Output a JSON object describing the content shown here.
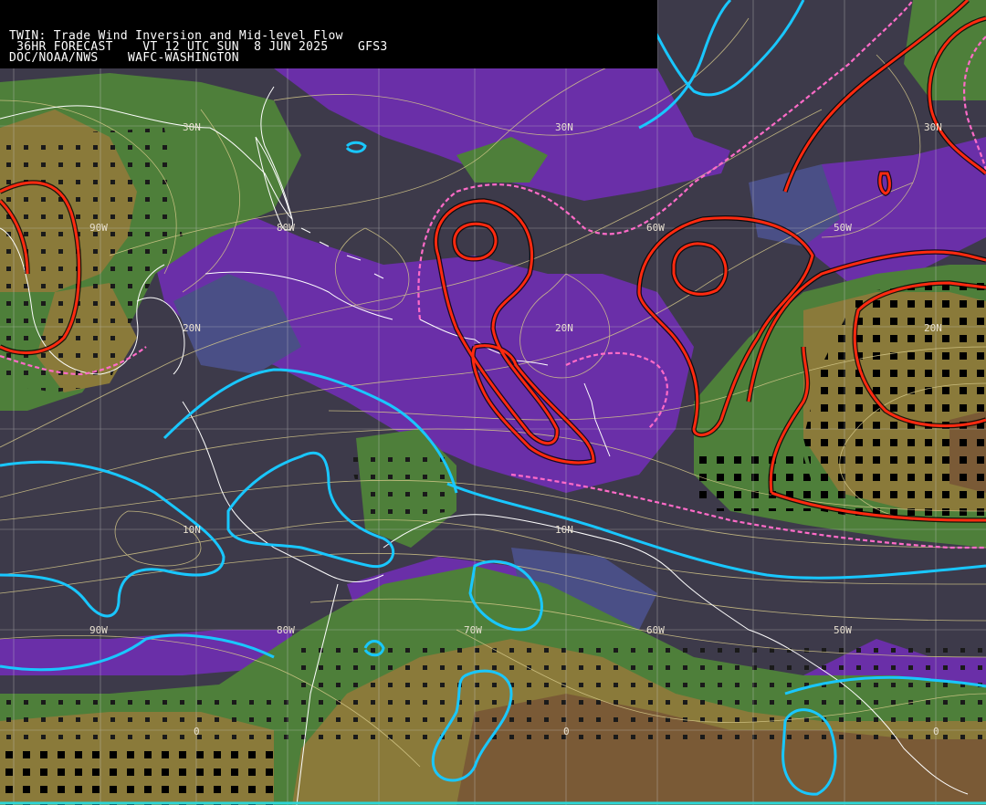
{
  "header": {
    "line1": "TWIN: Trade Wind Inversion and Mid-level Flow",
    "line2": " 36HR FORECAST    VT 12 UTC SUN  8 JUN 2025    GFS3",
    "line3": "DOC/NOAA/NWS    WAFC-WASHINGTON"
  },
  "grid_labels": {
    "lat": [
      "30N",
      "20N",
      "10N",
      "0"
    ],
    "lon": [
      "90W",
      "80W",
      "70W",
      "60W",
      "50W"
    ]
  },
  "colors": {
    "background": "#3d3a4a",
    "purple": "#6a2fa8",
    "slate_blue": "#4a4f86",
    "green": "#4e7f3a",
    "olive": "#8a7a3a",
    "brown": "#7a5a36",
    "red_contour": "#ff2a10",
    "pink_dashed": "#ff6bc8",
    "cyan_contour": "#19c7ff",
    "streamline": "#d6c98a",
    "grid": "#c8c8c8",
    "coastline": "#ffffff"
  }
}
